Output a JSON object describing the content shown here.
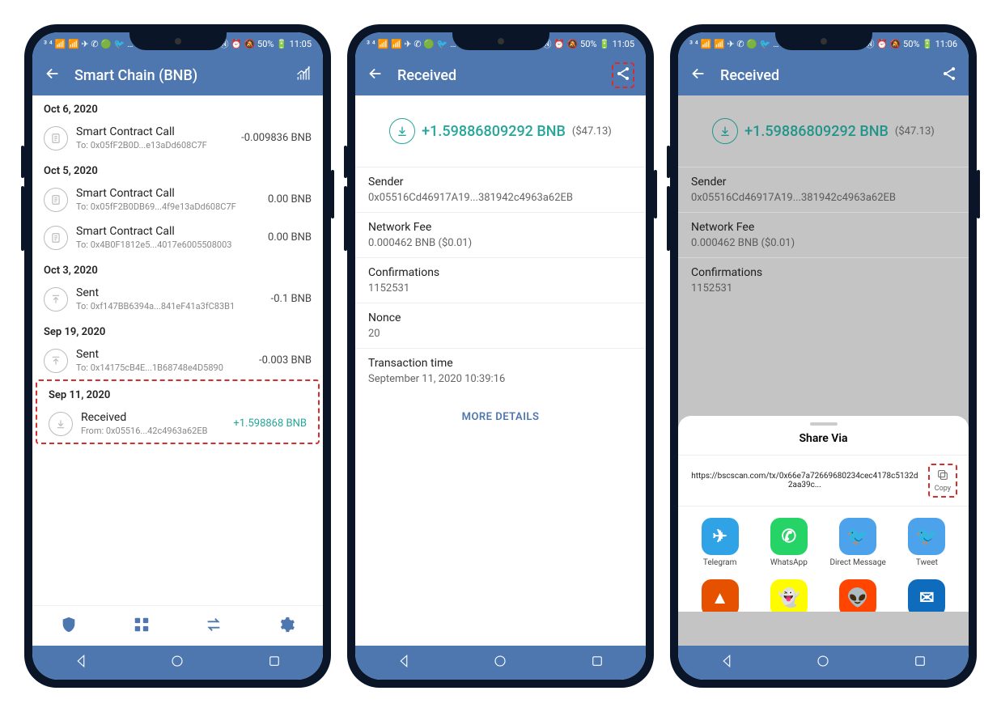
{
  "screen1": {
    "status": {
      "left": "³ ⁴ 📶 📶 ✈ ✆ 🟢 🐦 …",
      "right": "Ⓝ ⏰ 🔕 50% 🔋 11:05"
    },
    "title": "Smart Chain (BNB)",
    "groups": [
      {
        "date": "Oct 6, 2020",
        "txs": [
          {
            "kind": "contract",
            "title": "Smart Contract Call",
            "sub": "To: 0x05fF2B0D...e13aDd608C7F",
            "amount": "-0.009836 BNB"
          }
        ]
      },
      {
        "date": "Oct 5, 2020",
        "txs": [
          {
            "kind": "contract",
            "title": "Smart Contract Call",
            "sub": "To: 0x05fF2B0DB69...4f9e13aDd608C7F",
            "amount": "0.00 BNB"
          },
          {
            "kind": "contract",
            "title": "Smart Contract Call",
            "sub": "To: 0x4B0F1812e5...4017e6005508003",
            "amount": "0.00 BNB"
          }
        ]
      },
      {
        "date": "Oct 3, 2020",
        "txs": [
          {
            "kind": "sent",
            "title": "Sent",
            "sub": "To: 0xf147BB6394a...841eF41a3fC83B1",
            "amount": "-0.1 BNB"
          }
        ]
      },
      {
        "date": "Sep 19, 2020",
        "txs": [
          {
            "kind": "sent",
            "title": "Sent",
            "sub": "To: 0x14175cB4E...1B68748e4D5890",
            "amount": "-0.003 BNB"
          }
        ]
      },
      {
        "date": "Sep 11, 2020",
        "highlighted": true,
        "txs": [
          {
            "kind": "received",
            "title": "Received",
            "sub": "From: 0x05516...42c4963a62EB",
            "amount": "+1.598868 BNB",
            "positive": true
          }
        ]
      }
    ]
  },
  "screen2": {
    "status": {
      "left": "³ ⁴ 📶 📶 ✈ ✆ 🟢 🐦 …",
      "right": "Ⓝ ⏰ 🔕 50% 🔋 11:05"
    },
    "title": "Received",
    "hero": {
      "amount": "+1.59886809292 BNB",
      "usd": "($47.13)"
    },
    "details": [
      {
        "label": "Sender",
        "value": "0x05516Cd46917A19...381942c4963a62EB"
      },
      {
        "label": "Network Fee",
        "value": "0.000462 BNB ($0.01)"
      },
      {
        "label": "Confirmations",
        "value": "1152531"
      },
      {
        "label": "Nonce",
        "value": "20"
      },
      {
        "label": "Transaction time",
        "value": "September 11, 2020 10:39:16"
      }
    ],
    "more": "MORE DETAILS"
  },
  "screen3": {
    "status": {
      "left": "³ ⁴ 📶 📶 ✈ ✆ 🟢 🐦 …",
      "right": "Ⓝ ⏰ 🔕 50% 🔋 11:06"
    },
    "title": "Received",
    "hero": {
      "amount": "+1.59886809292 BNB",
      "usd": "($47.13)"
    },
    "details": [
      {
        "label": "Sender",
        "value": "0x05516Cd46917A19...381942c4963a62EB"
      },
      {
        "label": "Network Fee",
        "value": "0.000462 BNB ($0.01)"
      },
      {
        "label": "Confirmations",
        "value": "1152531"
      }
    ],
    "share": {
      "title": "Share Via",
      "url": "https://bscscan.com/tx/0x66e7a72669680234cec4178c5132d2aa39c...",
      "copy": "Copy",
      "apps_row1": [
        {
          "name": "Telegram",
          "bg": "#2fa3e6",
          "glyph": "✈"
        },
        {
          "name": "WhatsApp",
          "bg": "#25d366",
          "glyph": "✆"
        },
        {
          "name": "Direct Message",
          "bg": "#4da3eb",
          "glyph": "🐦"
        },
        {
          "name": "Tweet",
          "bg": "#4da3eb",
          "glyph": "🐦"
        }
      ],
      "apps_row2": [
        {
          "name": "",
          "bg": "#e65100",
          "glyph": "▲"
        },
        {
          "name": "",
          "bg": "#fffc00",
          "glyph": "👻"
        },
        {
          "name": "",
          "bg": "#ff4500",
          "glyph": "👽"
        },
        {
          "name": "",
          "bg": "#0f6cbd",
          "glyph": "✉"
        }
      ]
    }
  }
}
